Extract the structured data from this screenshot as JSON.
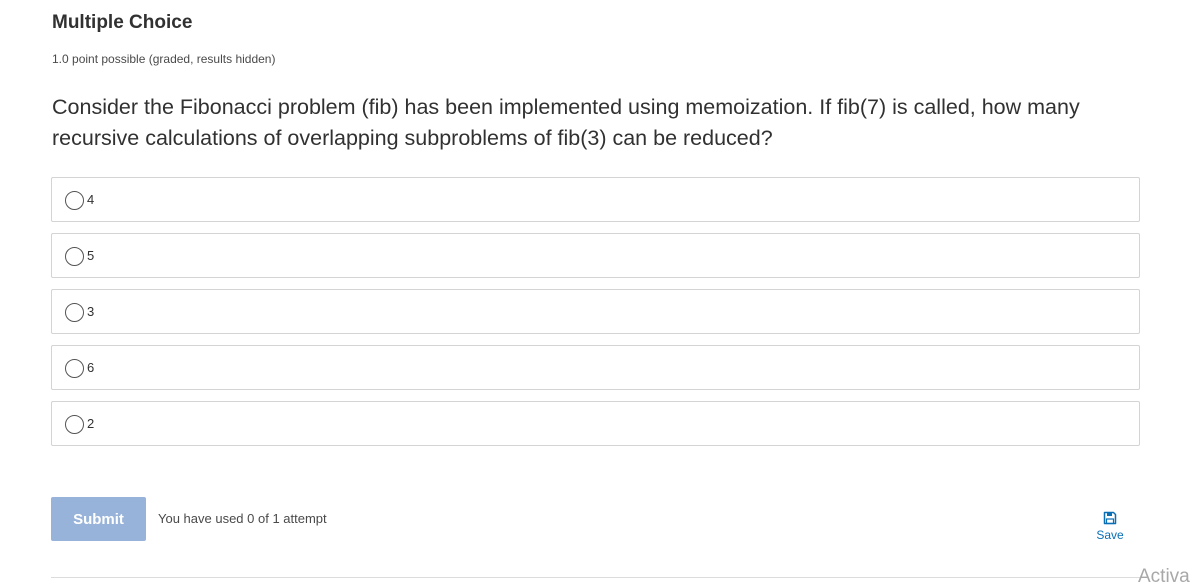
{
  "problem": {
    "title": "Multiple Choice",
    "progress": "1.0 point possible (graded, results hidden)",
    "question": "Consider the Fibonacci problem (fib) has been implemented using memoization. If fib(7) is called, how many recursive calculations of overlapping subproblems of fib(3) can be reduced?"
  },
  "choices": [
    {
      "label": "4"
    },
    {
      "label": "5"
    },
    {
      "label": "3"
    },
    {
      "label": "6"
    },
    {
      "label": "2"
    }
  ],
  "actions": {
    "submit_label": "Submit",
    "attempts_text": "You have used 0 of 1 attempt",
    "save_label": "Save",
    "save_icon": "floppy-disk-icon"
  },
  "watermark": "Activa",
  "colors": {
    "submit_bg": "#98b3d9",
    "link": "#0a6fb5",
    "border": "#d4d4d4"
  }
}
